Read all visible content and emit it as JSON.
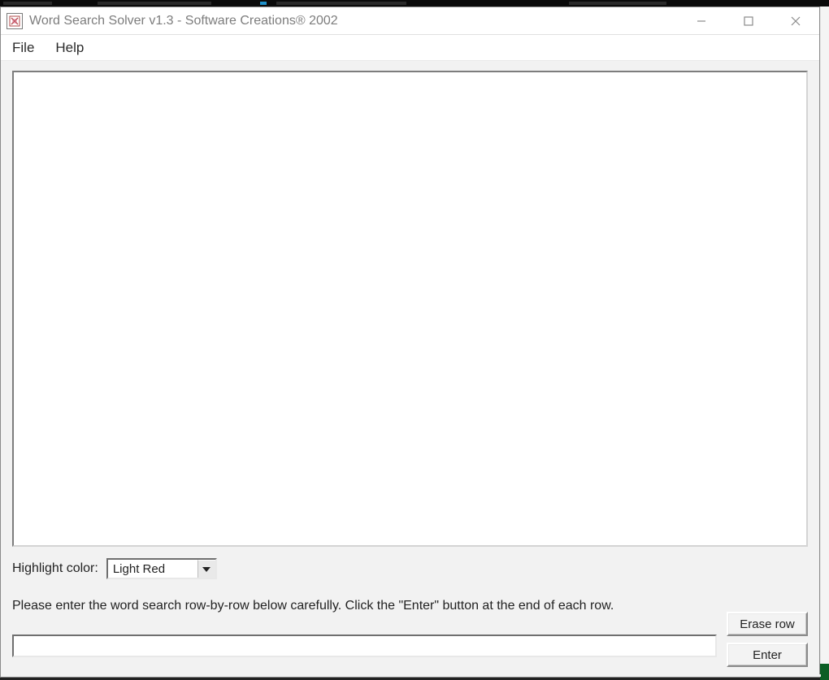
{
  "titlebar": {
    "title": "Word Search Solver v1.3 - Software Creations® 2002"
  },
  "menubar": {
    "file": "File",
    "help": "Help"
  },
  "highlight": {
    "label": "Highlight color:",
    "selected": "Light Red"
  },
  "instruction": "Please enter the word search row-by-row below carefully. Click the \"Enter\" button at the end of each row.",
  "input": {
    "row_value": ""
  },
  "buttons": {
    "erase": "Erase row",
    "enter": "Enter"
  }
}
